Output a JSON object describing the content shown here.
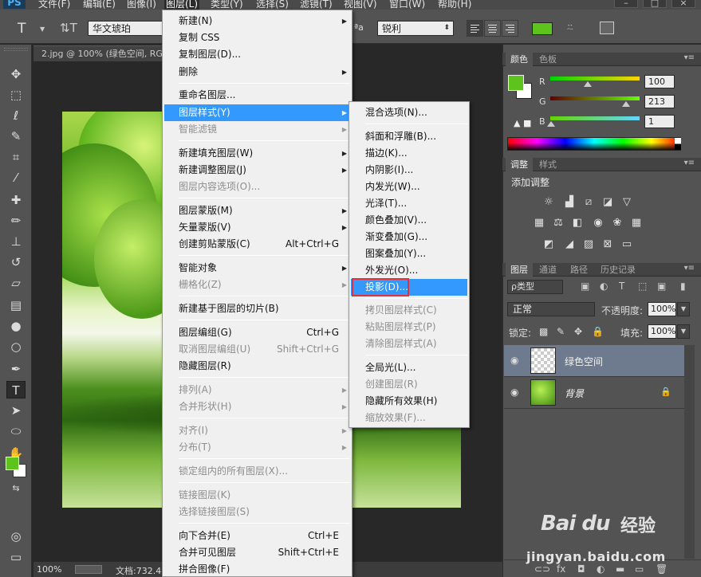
{
  "menubar": {
    "logo": "PS",
    "items": [
      "文件(F)",
      "编辑(E)",
      "图像(I)",
      "图层(L)",
      "类型(Y)",
      "选择(S)",
      "滤镜(T)",
      "视图(V)",
      "窗口(W)",
      "帮助(H)"
    ],
    "active_index": 3
  },
  "optbar": {
    "font_family": "华文琥珀",
    "aa_label": "ªa",
    "aa_method": "锐利",
    "text_color": "#5ec31d"
  },
  "document": {
    "tab_title": "2.jpg @ 100% (绿色空间, RGB/8)",
    "zoom": "100%",
    "doc_info": "文档:732.4"
  },
  "color_panel": {
    "tabs": [
      "颜色",
      "色板"
    ],
    "fg_color": "#5ec31d",
    "channels": [
      {
        "label": "R",
        "value": "100",
        "fraction": 0.39
      },
      {
        "label": "G",
        "value": "213",
        "fraction": 0.84
      },
      {
        "label": "B",
        "value": "1",
        "fraction": 0.0
      }
    ]
  },
  "adjust_panel": {
    "tabs": [
      "调整",
      "样式"
    ],
    "title": "添加调整"
  },
  "layers_panel": {
    "tabs": [
      "图层",
      "通道",
      "路径",
      "历史记录"
    ],
    "filter_label": "ρ类型",
    "blend_mode": "正常",
    "opacity_label": "不透明度:",
    "opacity_value": "100%",
    "lock_label": "锁定:",
    "fill_label": "填充:",
    "fill_value": "100%",
    "layers": [
      {
        "name": "绿色空间",
        "selected": true
      },
      {
        "name": "背景",
        "selected": false,
        "locked": true
      }
    ]
  },
  "layer_menu": {
    "items": [
      {
        "label": "新建(N)",
        "submenu": true
      },
      {
        "label": "复制 CSS"
      },
      {
        "label": "复制图层(D)..."
      },
      {
        "label": "删除",
        "submenu": true
      },
      {
        "sep": true
      },
      {
        "label": "重命名图层..."
      },
      {
        "label": "图层样式(Y)",
        "submenu": true,
        "highlighted": true
      },
      {
        "label": "智能滤镜",
        "submenu": true,
        "disabled": true
      },
      {
        "sep": true
      },
      {
        "label": "新建填充图层(W)",
        "submenu": true
      },
      {
        "label": "新建调整图层(J)",
        "submenu": true
      },
      {
        "label": "图层内容选项(O)...",
        "disabled": true
      },
      {
        "sep": true
      },
      {
        "label": "图层蒙版(M)",
        "submenu": true
      },
      {
        "label": "矢量蒙版(V)",
        "submenu": true
      },
      {
        "label": "创建剪贴蒙版(C)",
        "shortcut": "Alt+Ctrl+G"
      },
      {
        "sep": true
      },
      {
        "label": "智能对象",
        "submenu": true
      },
      {
        "label": "栅格化(Z)",
        "submenu": true,
        "disabled": true
      },
      {
        "sep": true
      },
      {
        "label": "新建基于图层的切片(B)"
      },
      {
        "sep": true
      },
      {
        "label": "图层编组(G)",
        "shortcut": "Ctrl+G"
      },
      {
        "label": "取消图层编组(U)",
        "shortcut": "Shift+Ctrl+G",
        "disabled": true
      },
      {
        "label": "隐藏图层(R)"
      },
      {
        "sep": true
      },
      {
        "label": "排列(A)",
        "submenu": true,
        "disabled": true
      },
      {
        "label": "合并形状(H)",
        "submenu": true,
        "disabled": true
      },
      {
        "sep": true
      },
      {
        "label": "对齐(I)",
        "submenu": true,
        "disabled": true
      },
      {
        "label": "分布(T)",
        "submenu": true,
        "disabled": true
      },
      {
        "sep": true
      },
      {
        "label": "锁定组内的所有图层(X)...",
        "disabled": true
      },
      {
        "sep": true
      },
      {
        "label": "链接图层(K)",
        "disabled": true
      },
      {
        "label": "选择链接图层(S)",
        "disabled": true
      },
      {
        "sep": true
      },
      {
        "label": "向下合并(E)",
        "shortcut": "Ctrl+E"
      },
      {
        "label": "合并可见图层",
        "shortcut": "Shift+Ctrl+E"
      },
      {
        "label": "拼合图像(F)"
      }
    ]
  },
  "style_menu": {
    "items": [
      {
        "label": "混合选项(N)..."
      },
      {
        "sep": true
      },
      {
        "label": "斜面和浮雕(B)..."
      },
      {
        "label": "描边(K)..."
      },
      {
        "label": "内阴影(I)..."
      },
      {
        "label": "内发光(W)..."
      },
      {
        "label": "光泽(T)..."
      },
      {
        "label": "颜色叠加(V)..."
      },
      {
        "label": "渐变叠加(G)..."
      },
      {
        "label": "图案叠加(Y)..."
      },
      {
        "label": "外发光(O)..."
      },
      {
        "label": "投影(D)...",
        "highlighted": true,
        "boxed": true
      },
      {
        "sep": true
      },
      {
        "label": "拷贝图层样式(C)",
        "disabled": true
      },
      {
        "label": "粘贴图层样式(P)",
        "disabled": true
      },
      {
        "label": "清除图层样式(A)",
        "disabled": true
      },
      {
        "sep": true
      },
      {
        "label": "全局光(L)..."
      },
      {
        "label": "创建图层(R)",
        "disabled": true
      },
      {
        "label": "隐藏所有效果(H)"
      },
      {
        "label": "缩放效果(F)...",
        "disabled": true
      }
    ]
  },
  "watermark": {
    "brand": "Bai du",
    "brand_cn": "经验",
    "url": "jingyan.baidu.com"
  }
}
